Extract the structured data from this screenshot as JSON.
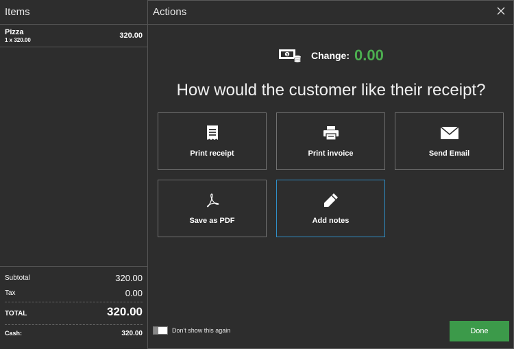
{
  "left": {
    "title": "Items",
    "items": [
      {
        "name": "Pizza",
        "qty": "1 x 320.00",
        "price": "320.00"
      }
    ],
    "totals": {
      "subtotal_label": "Subtotal",
      "subtotal_value": "320.00",
      "tax_label": "Tax",
      "tax_value": "0.00",
      "total_label": "TOTAL",
      "total_value": "320.00",
      "cash_label": "Cash:",
      "cash_value": "320.00"
    }
  },
  "right": {
    "title": "Actions",
    "change_label": "Change:",
    "change_value": "0.00",
    "question": "How would the customer like their receipt?",
    "buttons": [
      {
        "label": "Print receipt",
        "icon": "receipt-icon"
      },
      {
        "label": "Print invoice",
        "icon": "printer-icon"
      },
      {
        "label": "Send Email",
        "icon": "email-icon"
      },
      {
        "label": "Save as PDF",
        "icon": "pdf-icon"
      },
      {
        "label": "Add notes",
        "icon": "pencil-icon"
      }
    ],
    "dont_show_label": "Don't show this again",
    "done_label": "Done"
  },
  "colors": {
    "background": "#2d2d2d",
    "accent_green": "#4caf50",
    "done_green": "#3c9a4a",
    "focus_blue": "#2f8fc8"
  }
}
